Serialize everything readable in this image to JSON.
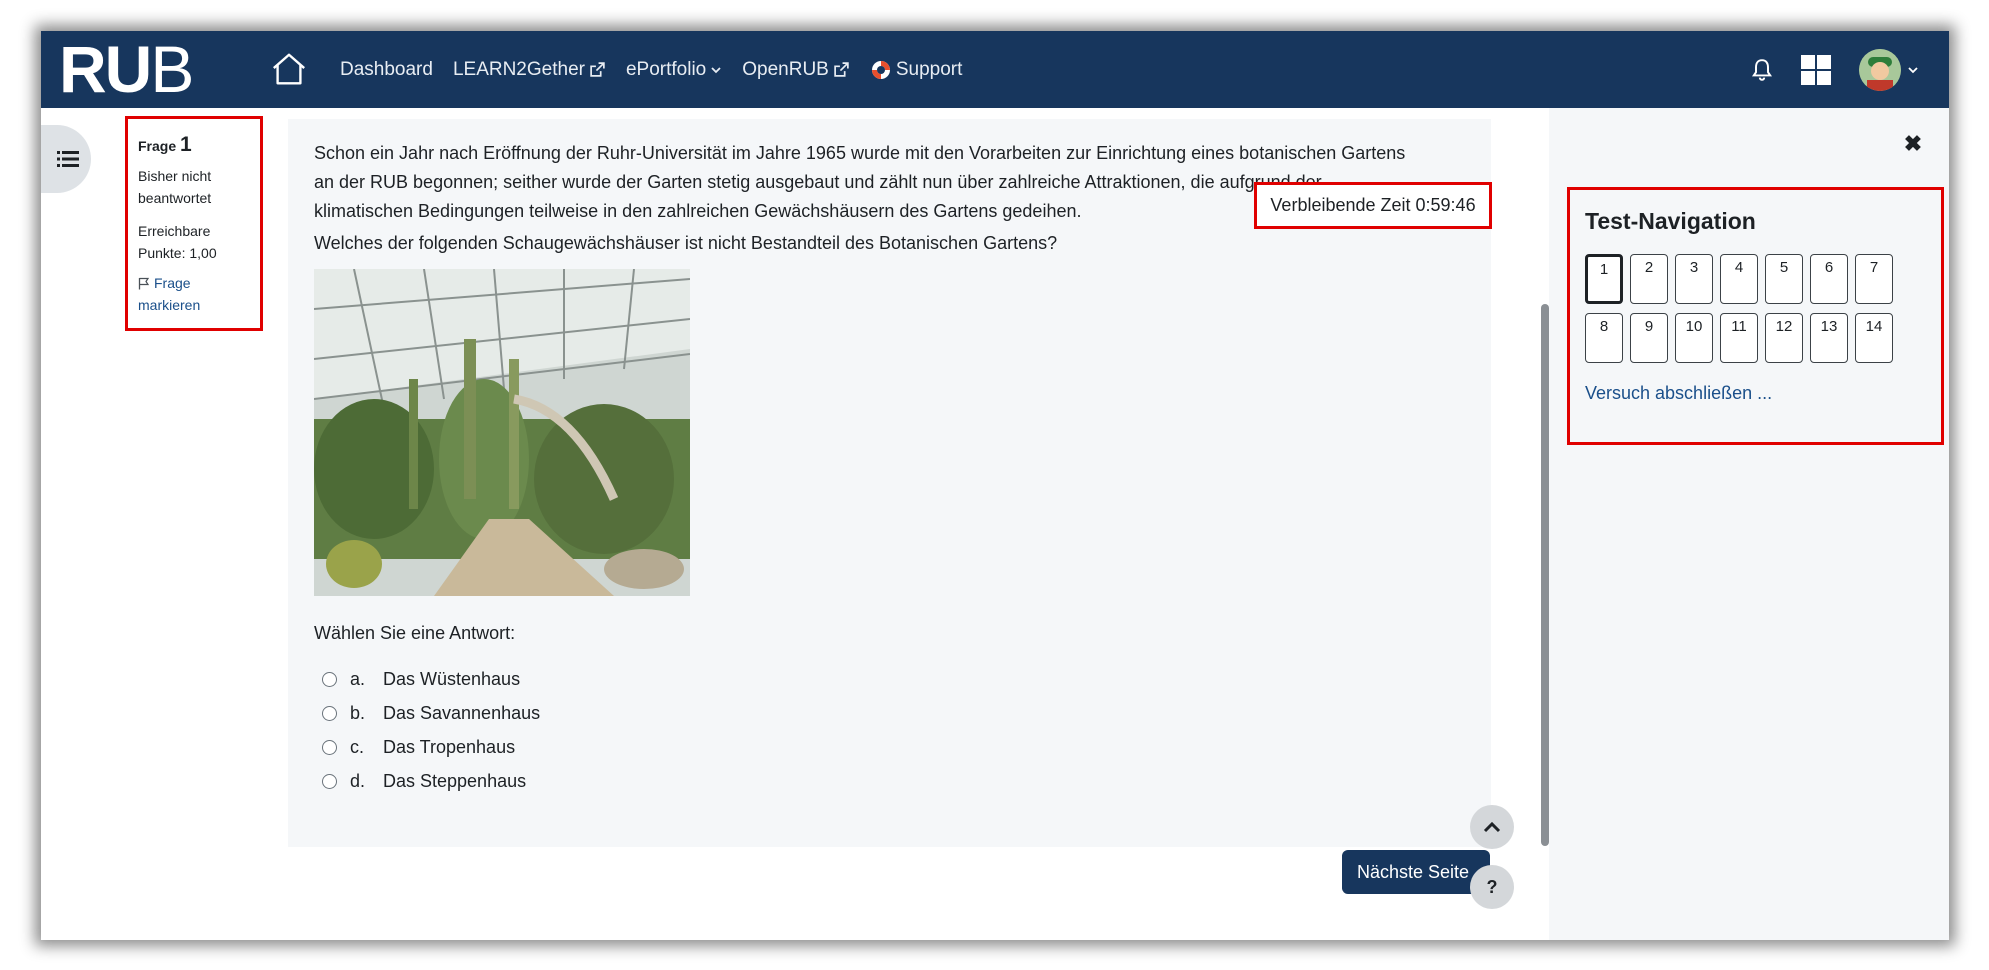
{
  "navbar": {
    "logo_bold": "RU",
    "logo_light": "B",
    "links": [
      {
        "label": "Dashboard",
        "icon": ""
      },
      {
        "label": "LEARN2Gether",
        "icon": "external-link-icon"
      },
      {
        "label": "ePortfolio",
        "icon": "chevron-down-icon"
      },
      {
        "label": "OpenRUB",
        "icon": "external-link-icon"
      },
      {
        "label": "Support",
        "icon": "lifebuoy-icon"
      }
    ],
    "icons": [
      "home-icon",
      "bell-icon",
      "grid-icon",
      "avatar",
      "chevron-down-icon"
    ]
  },
  "question_info": {
    "frage_label": "Frage",
    "number": "1",
    "status_line1": "Bisher nicht",
    "status_line2": "beantwortet",
    "points_line1": "Erreichbare",
    "points_line2": "Punkte: 1,00",
    "flag_line1": "Frage",
    "flag_line2": "markieren"
  },
  "question": {
    "line1": "Schon ein Jahr nach Eröffnung der Ruhr-Universität im Jahre 1965 wurde mit den Vorarbeiten zur Einrichtung eines botanischen Gartens",
    "line2": "an der RUB begonnen; seither wurde der Garten stetig ausgebaut und zählt nun über zahlreiche Attraktionen, die aufgrund der",
    "line3": "klimatischen Bedingungen teilweise in den zahlreichen Gewächshäusern des Gartens gedeihen.",
    "ask": "Welches der folgenden Schaugewächshäuser ist nicht Bestandteil des Botanischen Gartens?",
    "prompt": "Wählen Sie eine Antwort:",
    "answers": [
      {
        "letter": "a.",
        "text": "Das Wüstenhaus"
      },
      {
        "letter": "b.",
        "text": "Das Savannenhaus"
      },
      {
        "letter": "c.",
        "text": "Das Tropenhaus"
      },
      {
        "letter": "d.",
        "text": "Das Steppenhaus"
      }
    ]
  },
  "timer": {
    "label": "Verbleibende Zeit 0:59:46"
  },
  "buttons": {
    "next": "Nächste Seite",
    "help": "?"
  },
  "test_navigation": {
    "title": "Test-Navigation",
    "questions": [
      "1",
      "2",
      "3",
      "4",
      "5",
      "6",
      "7",
      "8",
      "9",
      "10",
      "11",
      "12",
      "13",
      "14"
    ],
    "current": "1",
    "finish": "Versuch abschließen ..."
  },
  "colors": {
    "navbar": "#17365d",
    "highlight": "#e00000",
    "link": "#1a4f8a",
    "card": "#f5f7f9"
  }
}
